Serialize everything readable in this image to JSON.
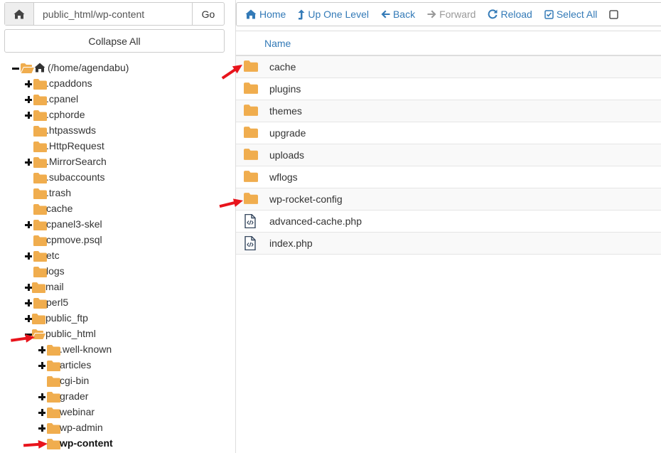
{
  "path_bar": {
    "path_value": "public_html/wp-content",
    "go_label": "Go"
  },
  "collapse_label": "Collapse All",
  "toolbar": {
    "home": "Home",
    "up_one_level": "Up One Level",
    "back": "Back",
    "forward": "Forward",
    "reload": "Reload",
    "select_all": "Select All"
  },
  "tree": {
    "root": "(/home/agendabu)",
    "items": [
      ".cpaddons",
      ".cpanel",
      ".cphorde",
      ".htpasswds",
      ".HttpRequest",
      ".MirrorSearch",
      ".subaccounts",
      ".trash",
      "cache",
      "cpanel3-skel",
      "cpmove.psql",
      "etc",
      "logs",
      "mail",
      "perl5",
      "public_ftp",
      "public_html"
    ],
    "public_html_children": [
      ".well-known",
      "articles",
      "cgi-bin",
      "grader",
      "webinar",
      "wp-admin",
      "wp-content"
    ]
  },
  "file_list": {
    "column_name": "Name",
    "rows": [
      {
        "name": "cache",
        "type": "folder"
      },
      {
        "name": "plugins",
        "type": "folder"
      },
      {
        "name": "themes",
        "type": "folder"
      },
      {
        "name": "upgrade",
        "type": "folder"
      },
      {
        "name": "uploads",
        "type": "folder"
      },
      {
        "name": "wflogs",
        "type": "folder"
      },
      {
        "name": "wp-rocket-config",
        "type": "folder"
      },
      {
        "name": "advanced-cache.php",
        "type": "php-file"
      },
      {
        "name": "index.php",
        "type": "php-file"
      }
    ]
  },
  "colors": {
    "folder": "#f0ad4e",
    "link": "#337ab7",
    "arrow": "#e8141c"
  }
}
